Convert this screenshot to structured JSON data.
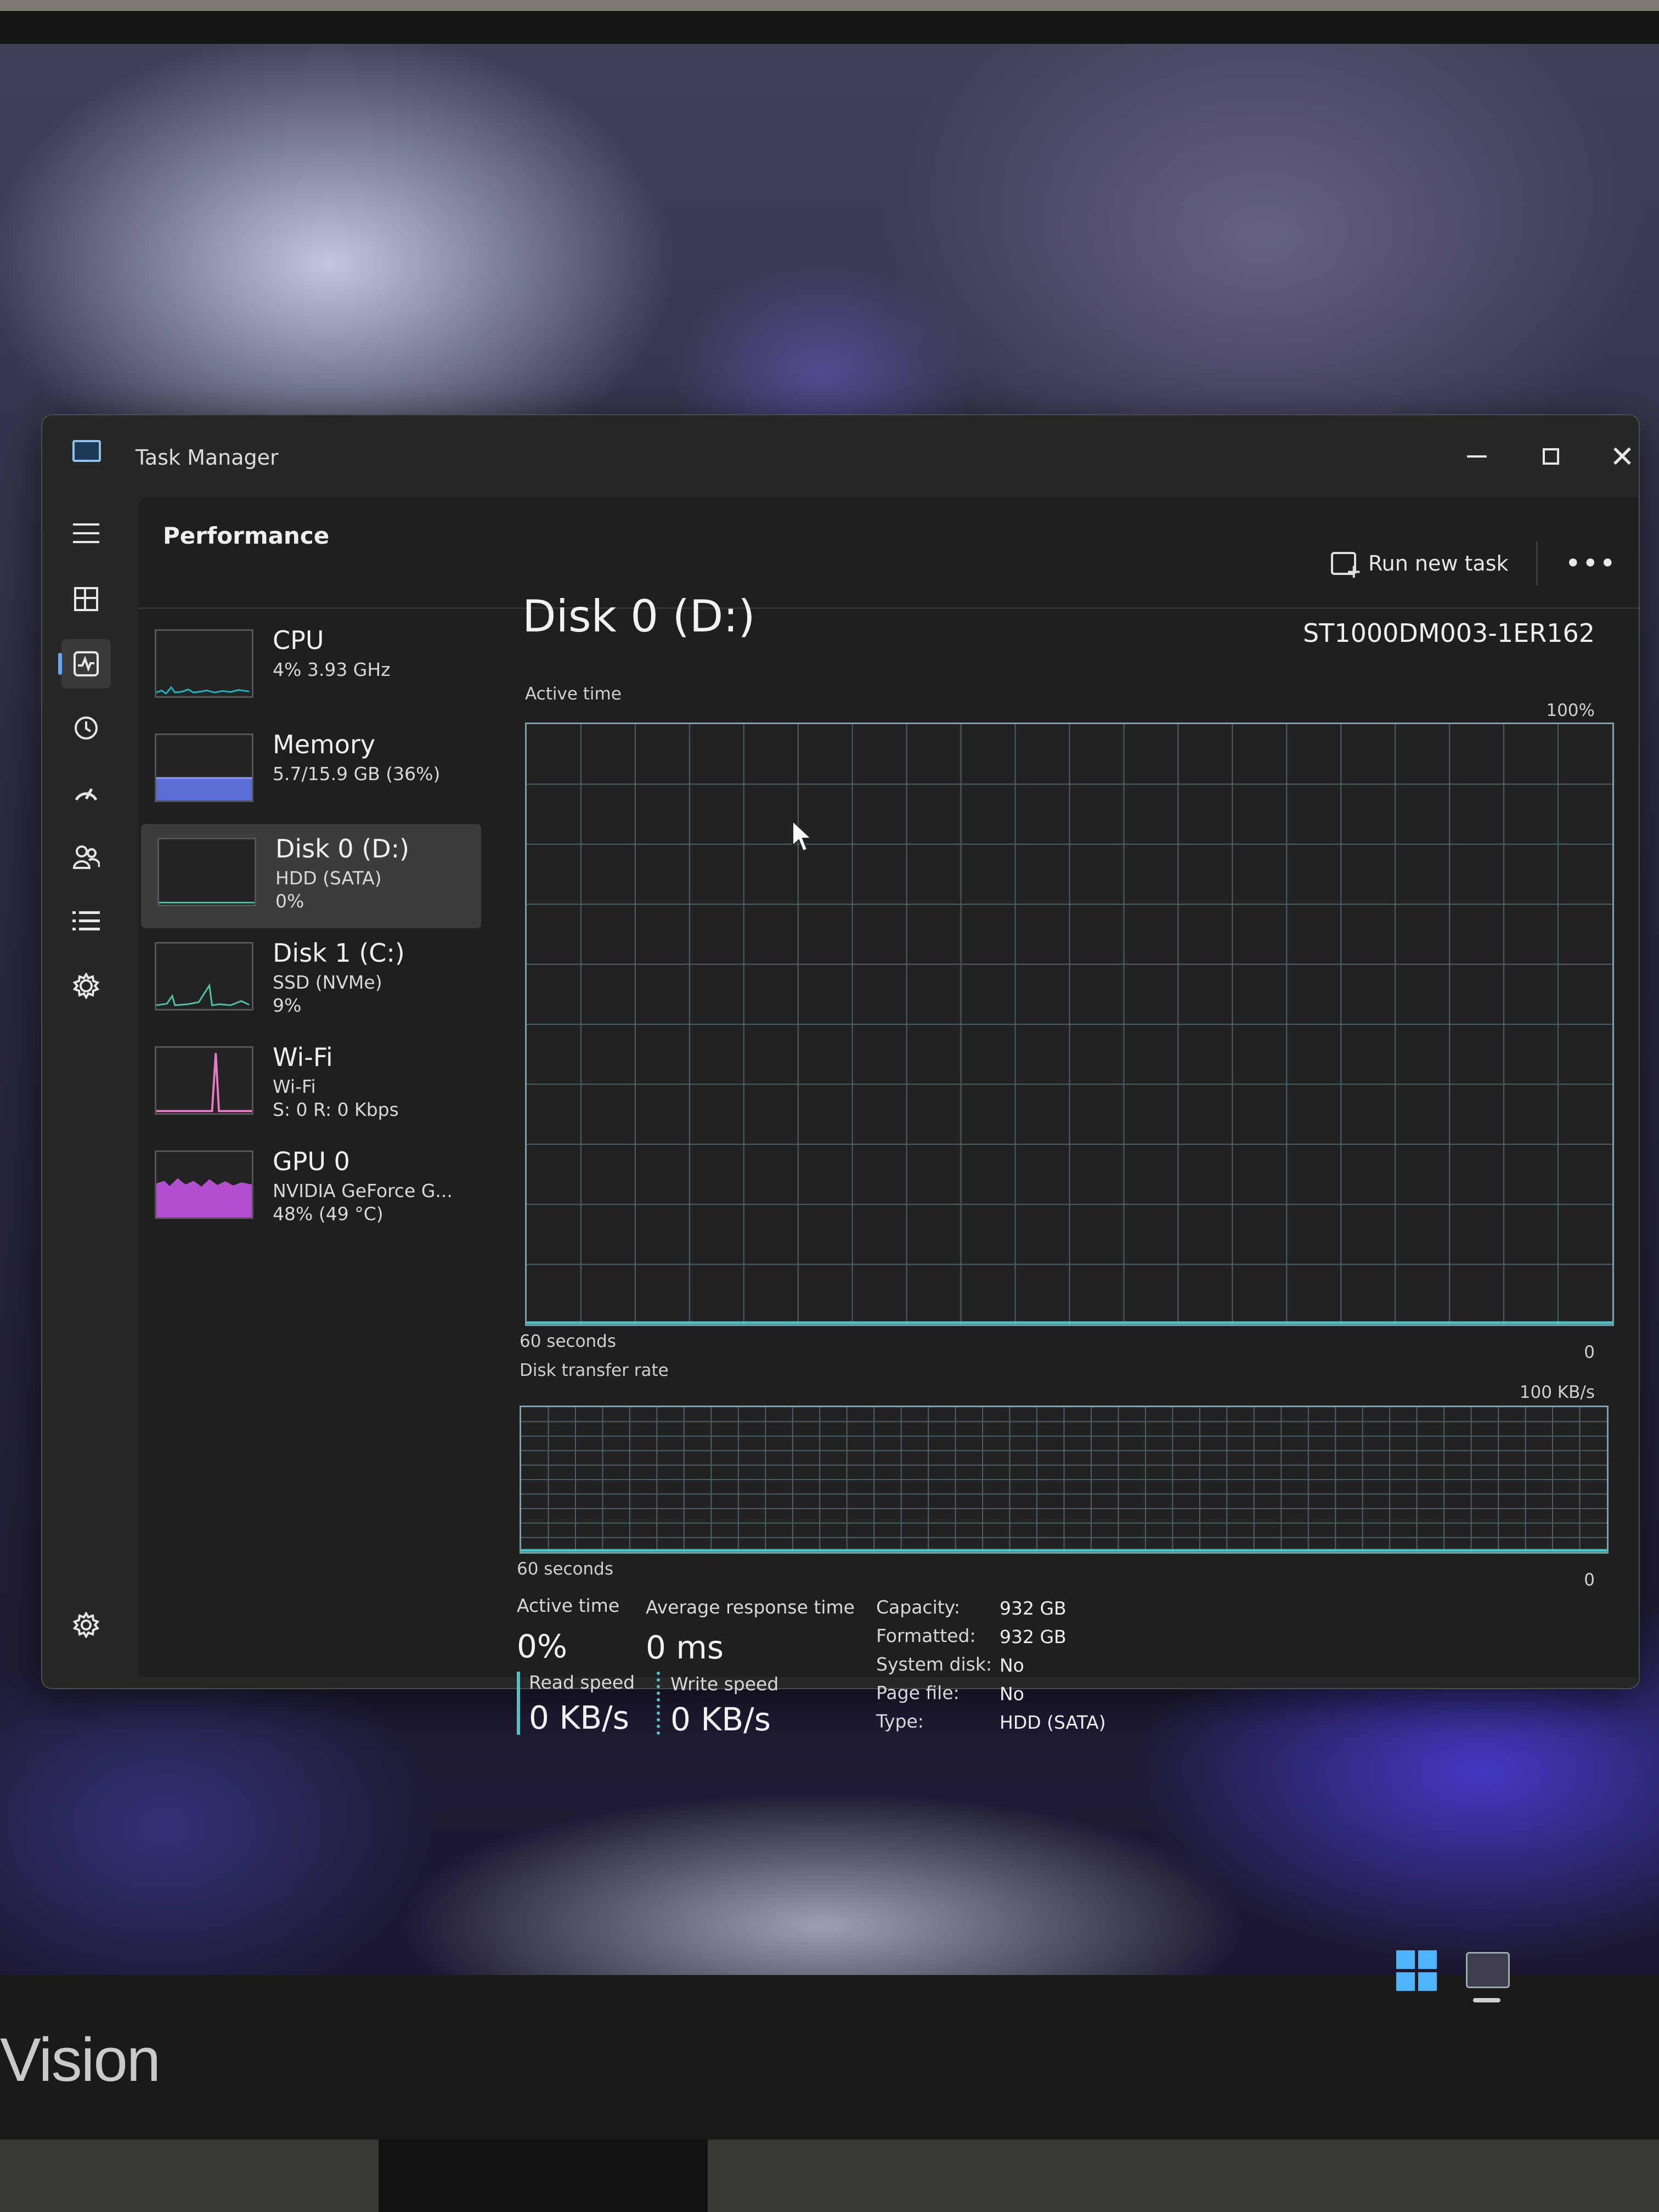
{
  "window": {
    "title": "Task Manager"
  },
  "page": {
    "title": "Performance",
    "run_new_task": "Run new task",
    "more": "•••"
  },
  "nav": {
    "items": [
      "hamburger-menu-icon",
      "processes-icon",
      "performance-icon",
      "app-history-icon",
      "startup-apps-icon",
      "users-icon",
      "details-icon",
      "services-icon",
      "settings-icon"
    ],
    "active": "performance-icon"
  },
  "perf_list": [
    {
      "name": "CPU",
      "sub1": "4% 3.93 GHz",
      "sub2": "",
      "sub3": "",
      "color": "#17b6c9"
    },
    {
      "name": "Memory",
      "sub1": "5.7/15.9 GB (36%)",
      "sub2": "",
      "sub3": "",
      "color": "#7a8cff"
    },
    {
      "name": "Disk 0 (D:)",
      "sub1": "HDD (SATA)",
      "sub2": "0%",
      "sub3": "",
      "color": "#4ec5a9"
    },
    {
      "name": "Disk 1 (C:)",
      "sub1": "SSD (NVMe)",
      "sub2": "9%",
      "sub3": "",
      "color": "#4ec5a9"
    },
    {
      "name": "Wi-Fi",
      "sub1": "Wi-Fi",
      "sub2": "S: 0 R: 0 Kbps",
      "sub3": "",
      "color": "#e879c4"
    },
    {
      "name": "GPU 0",
      "sub1": "NVIDIA GeForce G...",
      "sub2": "48% (49 °C)",
      "sub3": "",
      "color": "#c05fd8"
    }
  ],
  "detail": {
    "title": "Disk 0 (D:)",
    "model": "ST1000DM003-1ER162",
    "active_time_label": "Active time",
    "active_time_max": "100%",
    "active_time_span": "60 seconds",
    "active_time_min": "0",
    "transfer_label": "Disk transfer rate",
    "transfer_max": "100 KB/s",
    "transfer_span": "60 seconds",
    "transfer_min": "0",
    "line_color": "#4ec5c5"
  },
  "stats": {
    "active_time_label": "Active time",
    "active_time_value": "0%",
    "avg_response_label": "Average response time",
    "avg_response_value": "0 ms",
    "read_label": "Read speed",
    "read_value": "0 KB/s",
    "write_label": "Write speed",
    "write_value": "0 KB/s"
  },
  "properties": {
    "capacity_label": "Capacity:",
    "capacity_value": "932 GB",
    "formatted_label": "Formatted:",
    "formatted_value": "932 GB",
    "system_disk_label": "System disk:",
    "system_disk_value": "No",
    "page_file_label": "Page file:",
    "page_file_value": "No",
    "type_label": "Type:",
    "type_value": "HDD (SATA)"
  },
  "monitor": {
    "brand_text": "Vision"
  }
}
